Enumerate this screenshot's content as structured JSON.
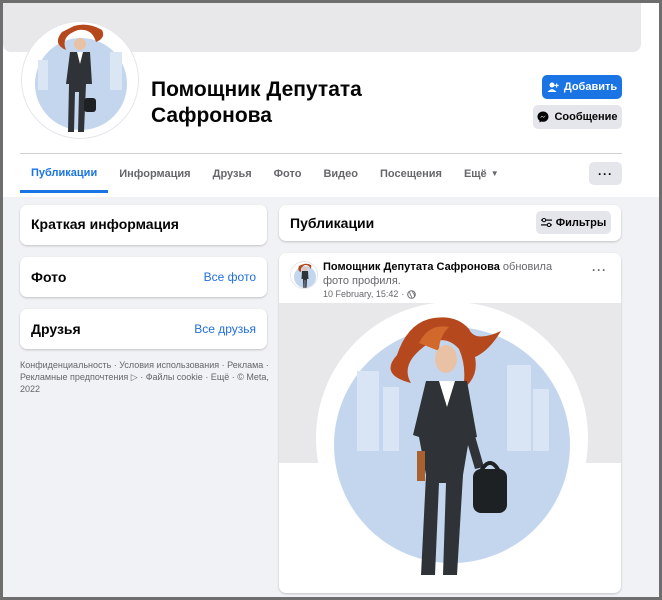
{
  "profile": {
    "name": "Помощник Депутата Сафронова",
    "add_label": "Добавить",
    "message_label": "Сообщение"
  },
  "tabs": [
    {
      "label": "Публикации",
      "active": true
    },
    {
      "label": "Информация"
    },
    {
      "label": "Друзья"
    },
    {
      "label": "Фото"
    },
    {
      "label": "Видео"
    },
    {
      "label": "Посещения"
    },
    {
      "label": "Ещё"
    }
  ],
  "more_label": "···",
  "left": {
    "intro_title": "Краткая информация",
    "photos_title": "Фото",
    "photos_link": "Все фото",
    "friends_title": "Друзья",
    "friends_link": "Все друзья",
    "footer_line1": "Конфиденциальность · Условия использования · Реклама ·",
    "footer_line2": "Рекламные предпочтения",
    "footer_line3": "· Файлы cookie · Ещё · © Meta,",
    "footer_line4": "2022"
  },
  "posts": {
    "title": "Публикации",
    "filters_label": "Фильтры",
    "author": "Помощник Депутата Сафронова",
    "action": "обновила фото профиля.",
    "time": "10 February, 15:42",
    "meta_sep": "·",
    "dots": "···"
  },
  "colors": {
    "accent": "#1b74e4",
    "link": "#216fdb",
    "avatar_bg": "#c4d6ee",
    "hair": "#b5481c",
    "suit": "#2f3337"
  }
}
